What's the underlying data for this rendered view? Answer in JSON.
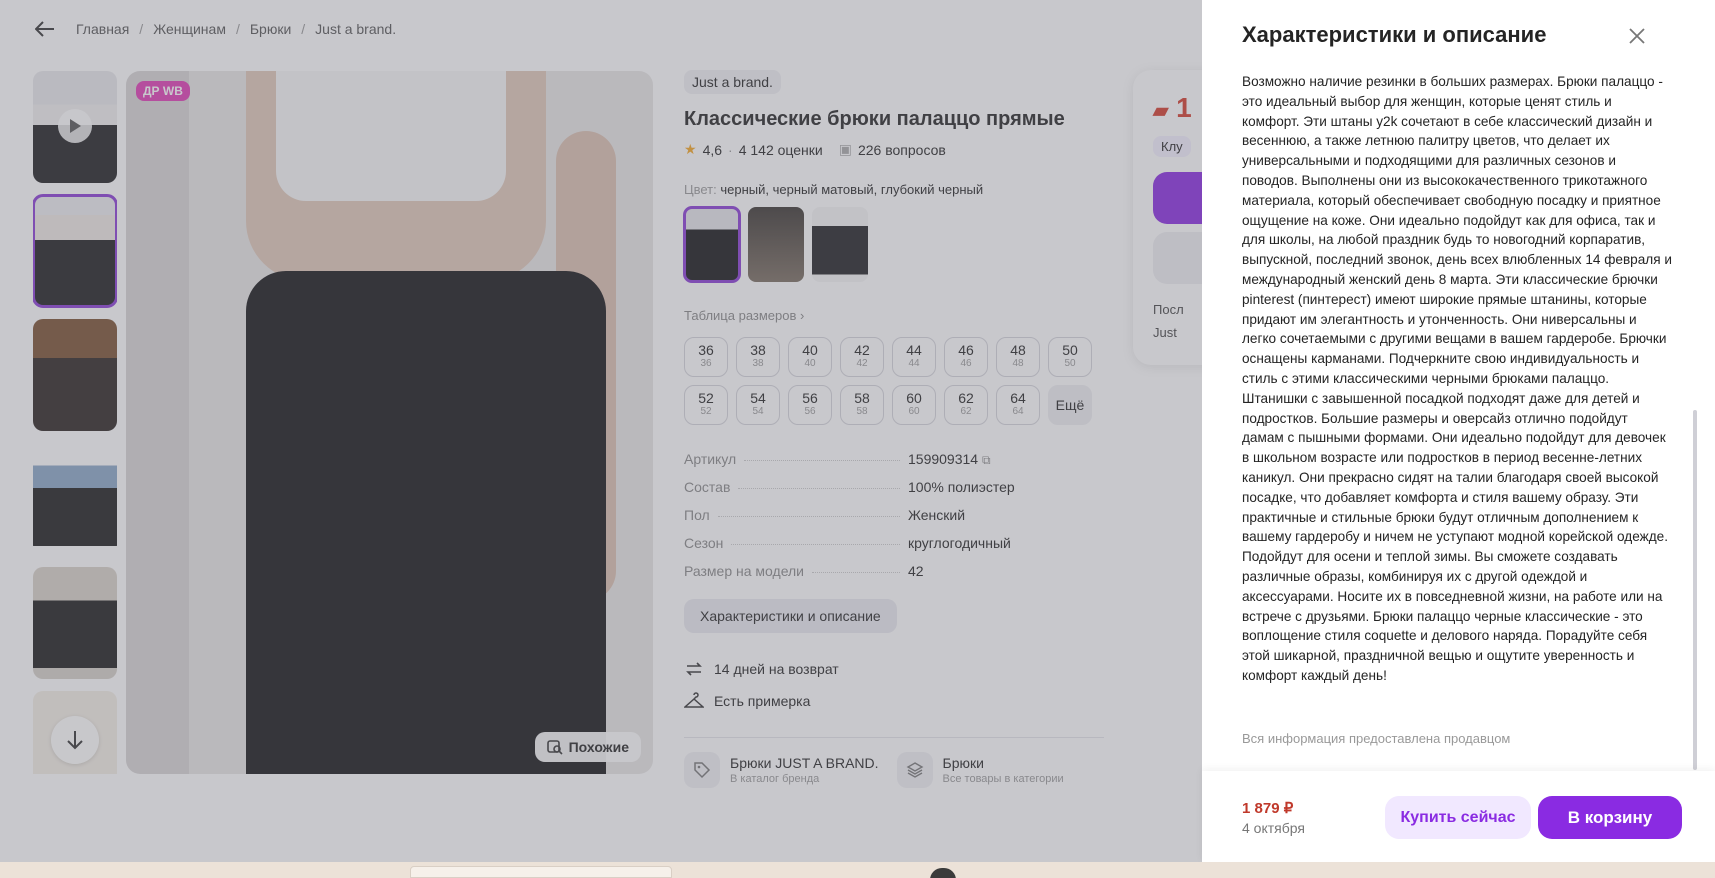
{
  "breadcrumb": [
    "Главная",
    "Женщинам",
    "Брюки",
    "Just a brand."
  ],
  "gallery": {
    "badge": "ДР WB",
    "similar_label": "Похожие"
  },
  "product": {
    "brand": "Just a brand.",
    "title": "Классические брюки палаццо прямые",
    "rating": "4,6",
    "reviews": "4 142 оценки",
    "questions": "226 вопросов",
    "color_label": "Цвет:",
    "color_value": "черный, черный матовый, глубокий черный",
    "size_table_label": "Таблица размеров",
    "sizes": [
      {
        "s": "36",
        "r": "36"
      },
      {
        "s": "38",
        "r": "38"
      },
      {
        "s": "40",
        "r": "40"
      },
      {
        "s": "42",
        "r": "42"
      },
      {
        "s": "44",
        "r": "44"
      },
      {
        "s": "46",
        "r": "46"
      },
      {
        "s": "48",
        "r": "48"
      },
      {
        "s": "50",
        "r": "50"
      },
      {
        "s": "52",
        "r": "52"
      },
      {
        "s": "54",
        "r": "54"
      },
      {
        "s": "56",
        "r": "56"
      },
      {
        "s": "58",
        "r": "58"
      },
      {
        "s": "60",
        "r": "60"
      },
      {
        "s": "62",
        "r": "62"
      },
      {
        "s": "64",
        "r": "64"
      }
    ],
    "more_sizes": "Ещё",
    "specs": [
      {
        "k": "Артикул",
        "v": "159909314"
      },
      {
        "k": "Состав",
        "v": "100% полиэстер"
      },
      {
        "k": "Пол",
        "v": "Женский"
      },
      {
        "k": "Сезон",
        "v": "круглогодичный"
      },
      {
        "k": "Размер на модели",
        "v": "42"
      }
    ],
    "desc_button": "Характеристики и описание",
    "perks": [
      "14 дней на возврат",
      "Есть примерка"
    ],
    "categories": [
      {
        "name": "Брюки JUST A BRAND.",
        "sub": "В каталог бренда"
      },
      {
        "name": "Брюки",
        "sub": "Все товары в категории"
      }
    ]
  },
  "buybox": {
    "price_partial": "1",
    "club_partial": "Клу",
    "line1": "Посл",
    "line2": "Just"
  },
  "drawer": {
    "title": "Характеристики и описание",
    "description": "Возможно наличие резинки в больших размерах. Брюки палаццо - это идеальный выбор для женщин, которые ценят стиль и комфорт. Эти штаны y2k сочетают в себе классический дизайн и весеннюю, а также летнюю палитру цветов, что делает их универсальными и подходящими для различных сезонов и поводов. Выполнены они из высококачественного трикотажного материала, который обеспечивает свободную посадку и приятное ощущение на коже. Они идеально подойдут как для офиса, так и для школы, на любой праздник будь то новогодний корпаратив, выпускной, последний звонок, день всех влюбленных 14 февраля и международный женский день 8 марта. Эти классические брючки pinterest (пинтерест) имеют широкие прямые штанины, которые придают им элегантность и утонченность. Они ниверсальны и легко сочетаемыми с другими вещами в вашем гардеробе. Брючки оснащены карманами. Подчеркните свою индивидуальность и стиль с этими классическими черными брюками палаццо. Штанишки с завышенной посадкой подходят даже для детей и подростков. Большие размеры и оверсайз отлично подойдут дамам с пышными формами. Они идеально подойдут для девочек в школьном возрасте или подростков в период весенне-летних каникул. Они прекрасно сидят на талии благодаря своей высокой посадке, что добавляет комфорта и стиля вашему образу. Эти практичные и стильные брюки будут отличным дополнением к вашему гардеробу и ничем не уступают модной корейской одежде. Подойдут для осени и теплой зимы. Вы сможете создавать различные образы, комбинируя их с другой одеждой и аксессуарами. Носите их в повседневной жизни, на работе или на встрече с друзьями. Брюки палаццо черные классические - это воплощение стиля coquette и делового наряда. Порадуйте себя этой шикарной, праздничной вещью и ощутите уверенность и комфорт каждый день!",
    "seller_note": "Вся информация предоставлена продавцом",
    "price": "1 879 ₽",
    "delivery_date": "4 октября",
    "buy_now": "Купить сейчас",
    "add_to_cart": "В корзину"
  },
  "colors": {
    "accent": "#8a2be2",
    "price": "#c0392b",
    "badge": "#e03ab5"
  }
}
